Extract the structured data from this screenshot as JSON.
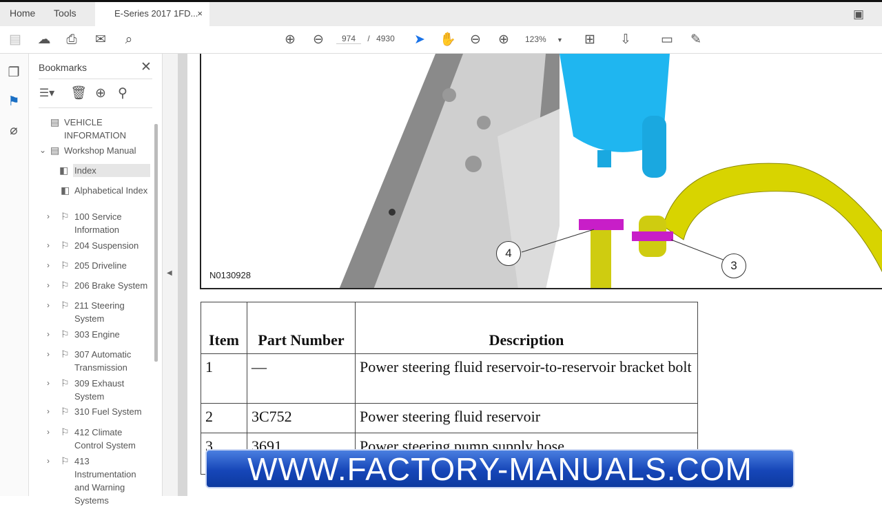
{
  "tabs": {
    "home": "Home",
    "tools": "Tools",
    "document": "E-Series 2017 1FD...",
    "close": "×"
  },
  "toolbar": {
    "current_page": "974",
    "page_sep": "/",
    "total_pages": "4930",
    "zoom": "123%"
  },
  "bookmarks": {
    "title": "Bookmarks",
    "items": [
      {
        "label": "VEHICLE INFORMATION"
      },
      {
        "label": "Workshop Manual"
      },
      {
        "label": "Index"
      },
      {
        "label": "Alphabetical Index"
      },
      {
        "label": "100 Service Information"
      },
      {
        "label": "204 Suspension"
      },
      {
        "label": "205 Driveline"
      },
      {
        "label": "206 Brake System"
      },
      {
        "label": "211 Steering System"
      },
      {
        "label": "303 Engine"
      },
      {
        "label": "307 Automatic Transmission"
      },
      {
        "label": "309 Exhaust System"
      },
      {
        "label": "310 Fuel System"
      },
      {
        "label": "412 Climate Control System"
      },
      {
        "label": "413 Instrumentation and Warning Systems"
      }
    ]
  },
  "figure": {
    "id": "N0130928",
    "callouts": [
      "4",
      "3"
    ],
    "colors": {
      "reservoir": "#1fb6f0",
      "hose": "#d8d400",
      "clamp": "#c81ec8"
    }
  },
  "table": {
    "headers": [
      "Item",
      "Part Number",
      "Description"
    ],
    "rows": [
      [
        "1",
        "—",
        "Power steering fluid reservoir-to-reservoir bracket bolt"
      ],
      [
        "2",
        "3C752",
        "Power steering fluid reservoir"
      ],
      [
        "3",
        "3691",
        "Power steering pump supply hose"
      ]
    ]
  },
  "banner": {
    "text": "WWW.FACTORY-MANUALS.COM"
  }
}
